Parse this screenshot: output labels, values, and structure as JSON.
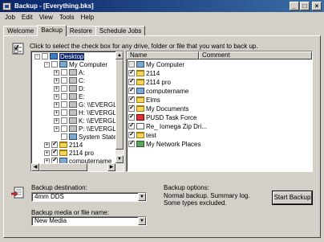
{
  "window": {
    "title": "Backup - [Everything.bks]",
    "controls": [
      "_",
      "□",
      "×"
    ]
  },
  "menu": [
    "Job",
    "Edit",
    "View",
    "Tools",
    "Help"
  ],
  "tabs": [
    "Welcome",
    "Backup",
    "Restore",
    "Schedule Jobs"
  ],
  "instruction": "Click to select the check box for any drive, folder or file that you want to back up.",
  "tree": {
    "rows": [
      {
        "label": "Desktop",
        "icon": "desktop-icon",
        "expander": "-",
        "checked": false,
        "selected": true
      },
      {
        "label": "My Computer",
        "icon": "computer-icon",
        "expander": "-",
        "checked": false
      },
      {
        "label": "A:",
        "icon": "drive-icon",
        "expander": "+",
        "checked": false
      },
      {
        "label": "C:",
        "icon": "drive-icon",
        "expander": "+",
        "checked": false
      },
      {
        "label": "D:",
        "icon": "drive-icon",
        "expander": "+",
        "checked": false
      },
      {
        "label": "E:",
        "icon": "drive-icon",
        "expander": "+",
        "checked": false
      },
      {
        "label": "G: \\\\EVERGL",
        "icon": "network-drive-icon",
        "expander": "+",
        "checked": false
      },
      {
        "label": "H: \\\\EVERGL",
        "icon": "network-drive-icon",
        "expander": "+",
        "checked": false
      },
      {
        "label": "K: \\\\EVERGL",
        "icon": "network-drive-icon",
        "expander": "+",
        "checked": false
      },
      {
        "label": "P: \\\\EVERGL",
        "icon": "network-drive-icon",
        "expander": "+",
        "checked": false
      },
      {
        "label": "System State",
        "icon": "computer-icon",
        "expander": "",
        "checked": false
      },
      {
        "label": "2114",
        "icon": "folder-icon",
        "expander": "+",
        "checked": true
      },
      {
        "label": "2114 pro",
        "icon": "folder-icon",
        "expander": "+",
        "checked": true
      },
      {
        "label": "computername",
        "icon": "computer-icon",
        "expander": "+",
        "checked": true
      }
    ]
  },
  "list": {
    "columns": [
      "Name",
      "Comment"
    ],
    "rows": [
      {
        "label": "My Computer",
        "icon": "computer-icon",
        "checked": false
      },
      {
        "label": "2114",
        "icon": "folder-icon",
        "checked": true
      },
      {
        "label": "2114 pro",
        "icon": "folder-icon",
        "checked": true
      },
      {
        "label": "computername",
        "icon": "computer-icon",
        "checked": true
      },
      {
        "label": "Elms",
        "icon": "folder-icon",
        "checked": true
      },
      {
        "label": "My Documents",
        "icon": "folder-icon",
        "checked": true
      },
      {
        "label": "PUSD Task Force",
        "icon": "document-icon",
        "checked": true
      },
      {
        "label": "Re_ Iomega Zip Dri...",
        "icon": "document-icon",
        "checked": true
      },
      {
        "label": "test",
        "icon": "folder-icon",
        "checked": true
      },
      {
        "label": "My Network Places",
        "icon": "network-icon",
        "checked": true
      }
    ]
  },
  "backup_destination": {
    "label": "Backup destination:",
    "value": "4mm DDS"
  },
  "backup_media": {
    "label": "Backup media or file name:",
    "value": "New Media"
  },
  "backup_options": {
    "label": "Backup options:",
    "line1": "Normal backup.  Summary log.",
    "line2": "Some types excluded."
  },
  "start_button": "Start Backup"
}
